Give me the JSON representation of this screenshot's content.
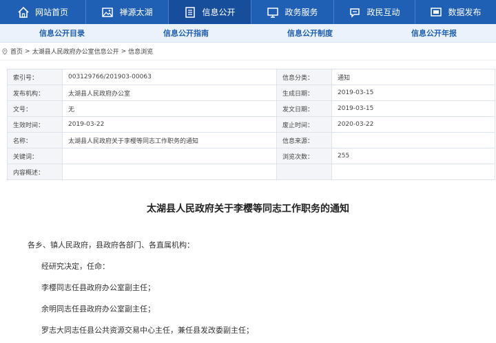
{
  "topnav": [
    {
      "label": "网站首页",
      "icon": "home-icon"
    },
    {
      "label": "禅源太湖",
      "icon": "image-icon"
    },
    {
      "label": "信息公开",
      "icon": "document-icon"
    },
    {
      "label": "政务服务",
      "icon": "monitor-icon"
    },
    {
      "label": "政民互动",
      "icon": "chat-icon"
    },
    {
      "label": "数据发布",
      "icon": "screen-icon"
    }
  ],
  "subnav": [
    "信息公开目录",
    "信息公开指南",
    "信息公开制度",
    "信息公开年报"
  ],
  "breadcrumb": {
    "home": "首页",
    "sep1": ">",
    "section": "太湖县人民政府办公室信息公开",
    "sep2": ">",
    "current": "信息浏览"
  },
  "info_table": [
    {
      "l1": "索引号：",
      "v1": "003129766/201903-00063",
      "l2": "信息分类：",
      "v2": "通知"
    },
    {
      "l1": "发布机构：",
      "v1": "太湖县人民政府办公室",
      "l2": "生成日期：",
      "v2": "2019-03-15"
    },
    {
      "l1": "文号：",
      "v1": "无",
      "l2": "发文日期：",
      "v2": "2019-03-15"
    },
    {
      "l1": "生效时间：",
      "v1": "2019-03-22",
      "l2": "废止时间：",
      "v2": "2020-03-22"
    },
    {
      "l1": "名称：",
      "v1": "太湖县人民政府关于李樱等同志工作职务的通知",
      "l2": "信息来源：",
      "v2": ""
    },
    {
      "l1": "关键词：",
      "v1": "",
      "l2": "浏览次数：",
      "v2": "255"
    },
    {
      "l1": "内容概述：",
      "v1": "",
      "l2": "",
      "v2": ""
    }
  ],
  "article": {
    "title": "太湖县人民政府关于李樱等同志工作职务的通知",
    "paragraphs": [
      "各乡、镇人民政府，县政府各部门、各直属机构：",
      "经研究决定，任命：",
      "李樱同志任县政府办公室副主任；",
      "余明同志任县政府办公室副主任；",
      "罗志大同志任县公共资源交易中心主任，兼任县发改委副主任；"
    ]
  },
  "colors": {
    "nav_bg": "#1f5fb4",
    "nav_active": "#174e9c",
    "subnav_bg": "#eaf2fb",
    "accent": "#1f5fb4"
  }
}
